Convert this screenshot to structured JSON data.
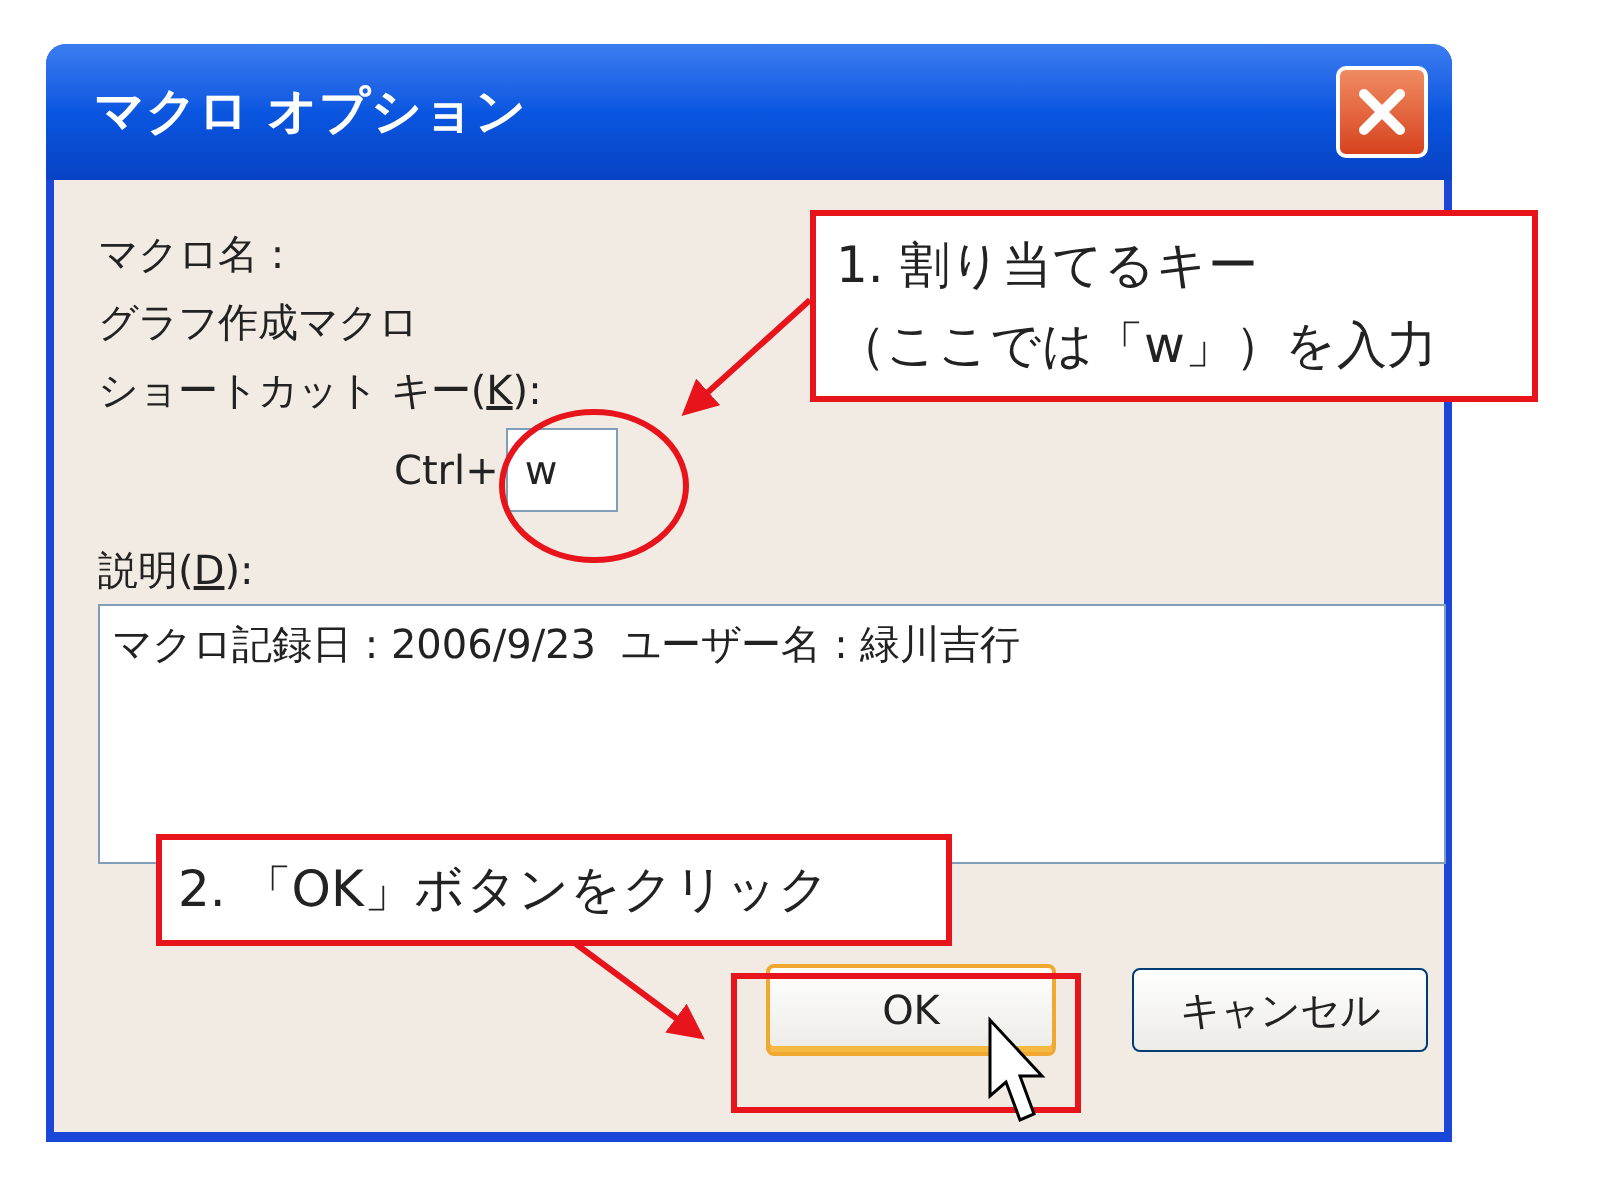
{
  "window": {
    "title": "マクロ オプション"
  },
  "form": {
    "macro_name_label": "マクロ名 :",
    "macro_name": "グラフ作成マクロ",
    "shortcut_label": [
      "ショートカット キー(",
      "K",
      "):"
    ],
    "ctrl_label": "Ctrl+",
    "shortcut_value": "w",
    "description_label": [
      "説明(",
      "D",
      "):"
    ],
    "description": "マクロ記録日 : 2006/9/23  ユーザー名 : 緑川吉行"
  },
  "buttons": [
    {
      "label": "OK",
      "selected": true
    },
    {
      "label": "キャンセル",
      "selected": false
    }
  ],
  "callouts": [
    {
      "lines": [
        "1. 割り当てるキー",
        "（ここでは「w」）を入力"
      ]
    },
    {
      "lines": [
        "2. 「OK」ボタンをクリック"
      ]
    }
  ]
}
